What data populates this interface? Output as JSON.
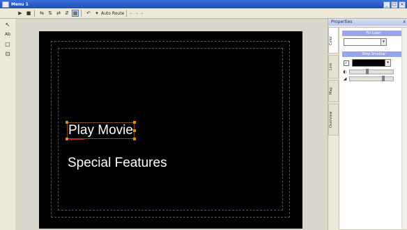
{
  "window": {
    "title": "Menu 1",
    "controls": [
      "_",
      "□",
      "×"
    ]
  },
  "toolbar": {
    "buttons": [
      "▶",
      "■",
      "⇆",
      "⇅",
      "⇄",
      "⇵",
      "▦",
      "↶",
      "▾"
    ],
    "autoroute_label": "Auto Route",
    "arrows": "⇠ ⇢ ⇢"
  },
  "tools": [
    "↖",
    "Ab",
    "▢",
    "⊡"
  ],
  "stage": {
    "items": [
      {
        "label": "Play Movie",
        "selected": true
      },
      {
        "label": "Special Features",
        "selected": false
      }
    ]
  },
  "properties": {
    "title": "Properties",
    "close": "x",
    "tabs": [
      "Color",
      "Link",
      "Map",
      "Overview"
    ],
    "sections": {
      "fill": "Fill Color",
      "stroke": "Drop Shadow"
    },
    "fill_color": "#ffffff",
    "stroke_color": "#000000",
    "shadow_enabled": true,
    "opacity_level": 0.4,
    "size_level": 0.8
  },
  "colors": {
    "stage_bg": "#000000",
    "menu_text": "#ffffff",
    "selection": "#e28a1c"
  }
}
